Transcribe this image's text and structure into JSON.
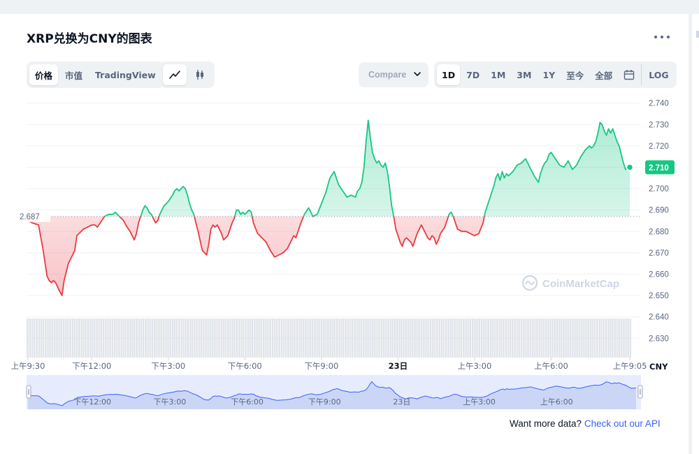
{
  "title": "XRP兑换为CNY的图表",
  "toolbar": {
    "type_tabs": [
      "价格",
      "市值",
      "TradingView"
    ],
    "active_type": "价格",
    "style_icons": [
      "line-chart-icon",
      "candlestick-icon"
    ],
    "active_style": "line-chart-icon",
    "compare_label": "Compare",
    "range_tabs": [
      "1D",
      "7D",
      "1M",
      "3M",
      "1Y",
      "至今",
      "全部"
    ],
    "active_range": "1D",
    "calendar_icon": "calendar-icon",
    "log_label": "LOG"
  },
  "footer": {
    "text": "Want more data?",
    "link": "Check out our API"
  },
  "colors": {
    "up": "#16c784",
    "down": "#ea3943",
    "accent": "#3861fb",
    "label_bg": "#16c784"
  },
  "watermark": "CoinMarketCap",
  "chart_data": {
    "type": "line",
    "currency_label": "CNY",
    "y_ticks": [
      2.74,
      2.73,
      2.72,
      2.71,
      2.7,
      2.69,
      2.68,
      2.67,
      2.66,
      2.65,
      2.64,
      2.63
    ],
    "y_tick_labels": [
      "2.740",
      "2.730",
      "2.720",
      "2.710",
      "2.700",
      "2.690",
      "2.680",
      "2.670",
      "2.660",
      "2.650",
      "2.640",
      "2.630"
    ],
    "ylim": [
      2.6265,
      2.7435
    ],
    "baseline": 2.687,
    "baseline_label": "2.687",
    "current_value": 2.71,
    "current_label": "2.710",
    "x_ticks": [
      {
        "label": "上午9:30",
        "t": 0,
        "bold": false
      },
      {
        "label": "下午12:00",
        "t": 150,
        "bold": false
      },
      {
        "label": "下午3:00",
        "t": 330,
        "bold": false
      },
      {
        "label": "下午6:00",
        "t": 510,
        "bold": false
      },
      {
        "label": "下午9:00",
        "t": 690,
        "bold": false
      },
      {
        "label": "23日",
        "t": 870,
        "bold": true
      },
      {
        "label": "上午3:00",
        "t": 1050,
        "bold": false
      },
      {
        "label": "上午6:00",
        "t": 1230,
        "bold": false
      },
      {
        "label": "上午9:05",
        "t": 1415,
        "bold": false
      }
    ],
    "navigator_ticks": [
      "下午12:00",
      "下午3:00",
      "下午6:00",
      "下午9:00",
      "23日",
      "上午3:00",
      "上午6:00"
    ],
    "series": [
      {
        "t": [
          0,
          10,
          25,
          35,
          45,
          50,
          55,
          60,
          65,
          72,
          80,
          85,
          90,
          95,
          100,
          105,
          110,
          115,
          120,
          130,
          140,
          150,
          158,
          163,
          170,
          180,
          190,
          200,
          205,
          210,
          215,
          220,
          225,
          230,
          240,
          250,
          255,
          260,
          265,
          270,
          275,
          280,
          285,
          290,
          295,
          300,
          305,
          310,
          320,
          330,
          340,
          345,
          350,
          355,
          360,
          365,
          370,
          375,
          380,
          385,
          390,
          395,
          400,
          410,
          420,
          425,
          430,
          435,
          440,
          445,
          450,
          455,
          460,
          470,
          475,
          480,
          485,
          490,
          495,
          500,
          505,
          510,
          515,
          520,
          525,
          530,
          540,
          550,
          560,
          570,
          580,
          590,
          600,
          610,
          620,
          625,
          630,
          635,
          640,
          650,
          660,
          670,
          680,
          690,
          700,
          710,
          720,
          730,
          740,
          750,
          760,
          770,
          775,
          780,
          785,
          790,
          795,
          800,
          805,
          810,
          815,
          820,
          825,
          830,
          835,
          840,
          845,
          850,
          855,
          860,
          865,
          870,
          875,
          880,
          885,
          890,
          900,
          905,
          910,
          915,
          920,
          925,
          930,
          935,
          940,
          945,
          950,
          955,
          960,
          965,
          970,
          980,
          985,
          990,
          995,
          1000,
          1005,
          1010,
          1020,
          1030,
          1040,
          1050,
          1060,
          1070,
          1075,
          1080,
          1085,
          1090,
          1095,
          1100,
          1105,
          1110,
          1115,
          1120,
          1125,
          1130,
          1140,
          1150,
          1160,
          1170,
          1175,
          1180,
          1190,
          1200,
          1205,
          1210,
          1215,
          1220,
          1225,
          1230,
          1240,
          1250,
          1260,
          1270,
          1280,
          1290,
          1300,
          1310,
          1320,
          1325,
          1330,
          1335,
          1340,
          1345,
          1350,
          1355,
          1360,
          1365,
          1370,
          1375,
          1380,
          1385,
          1390,
          1395,
          1400,
          1405,
          1410,
          1415
        ],
        "values": [
          2.685,
          2.684,
          2.683,
          2.672,
          2.659,
          2.657,
          2.656,
          2.657,
          2.656,
          2.653,
          2.65,
          2.657,
          2.661,
          2.665,
          2.667,
          2.669,
          2.671,
          2.678,
          2.679,
          2.681,
          2.682,
          2.683,
          2.683,
          2.682,
          2.684,
          2.687,
          2.688,
          2.688,
          2.689,
          2.688,
          2.687,
          2.686,
          2.685,
          2.683,
          2.68,
          2.676,
          2.679,
          2.684,
          2.687,
          2.69,
          2.692,
          2.691,
          2.689,
          2.688,
          2.686,
          2.684,
          2.685,
          2.688,
          2.692,
          2.694,
          2.697,
          2.699,
          2.7,
          2.699,
          2.7,
          2.701,
          2.7,
          2.697,
          2.693,
          2.69,
          2.688,
          2.684,
          2.68,
          2.671,
          2.669,
          2.674,
          2.681,
          2.683,
          2.682,
          2.683,
          2.681,
          2.679,
          2.676,
          2.678,
          2.681,
          2.684,
          2.686,
          2.69,
          2.69,
          2.688,
          2.689,
          2.688,
          2.689,
          2.69,
          2.689,
          2.684,
          2.679,
          2.677,
          2.675,
          2.671,
          2.668,
          2.669,
          2.67,
          2.672,
          2.676,
          2.678,
          2.677,
          2.68,
          2.683,
          2.688,
          2.691,
          2.687,
          2.688,
          2.693,
          2.698,
          2.705,
          2.708,
          2.702,
          2.699,
          2.696,
          2.697,
          2.696,
          2.699,
          2.7,
          2.703,
          2.71,
          2.722,
          2.732,
          2.724,
          2.717,
          2.714,
          2.712,
          2.713,
          2.711,
          2.71,
          2.712,
          2.708,
          2.701,
          2.692,
          2.687,
          2.681,
          2.678,
          2.675,
          2.673,
          2.676,
          2.677,
          2.675,
          2.673,
          2.676,
          2.679,
          2.681,
          2.683,
          2.681,
          2.679,
          2.677,
          2.676,
          2.678,
          2.677,
          2.674,
          2.676,
          2.679,
          2.682,
          2.685,
          2.688,
          2.689,
          2.687,
          2.684,
          2.681,
          2.68,
          2.68,
          2.679,
          2.678,
          2.679,
          2.684,
          2.689,
          2.692,
          2.695,
          2.698,
          2.701,
          2.705,
          2.707,
          2.704,
          2.708,
          2.705,
          2.707,
          2.706,
          2.708,
          2.711,
          2.712,
          2.714,
          2.712,
          2.71,
          2.706,
          2.703,
          2.707,
          2.71,
          2.712,
          2.713,
          2.716,
          2.717,
          2.714,
          2.711,
          2.71,
          2.713,
          2.709,
          2.711,
          2.715,
          2.718,
          2.72,
          2.719,
          2.72,
          2.722,
          2.726,
          2.731,
          2.73,
          2.727,
          2.725,
          2.728,
          2.726,
          2.728,
          2.725,
          2.722,
          2.72,
          2.716,
          2.712,
          2.709,
          2.71,
          2.71
        ]
      }
    ],
    "volume": "even"
  }
}
